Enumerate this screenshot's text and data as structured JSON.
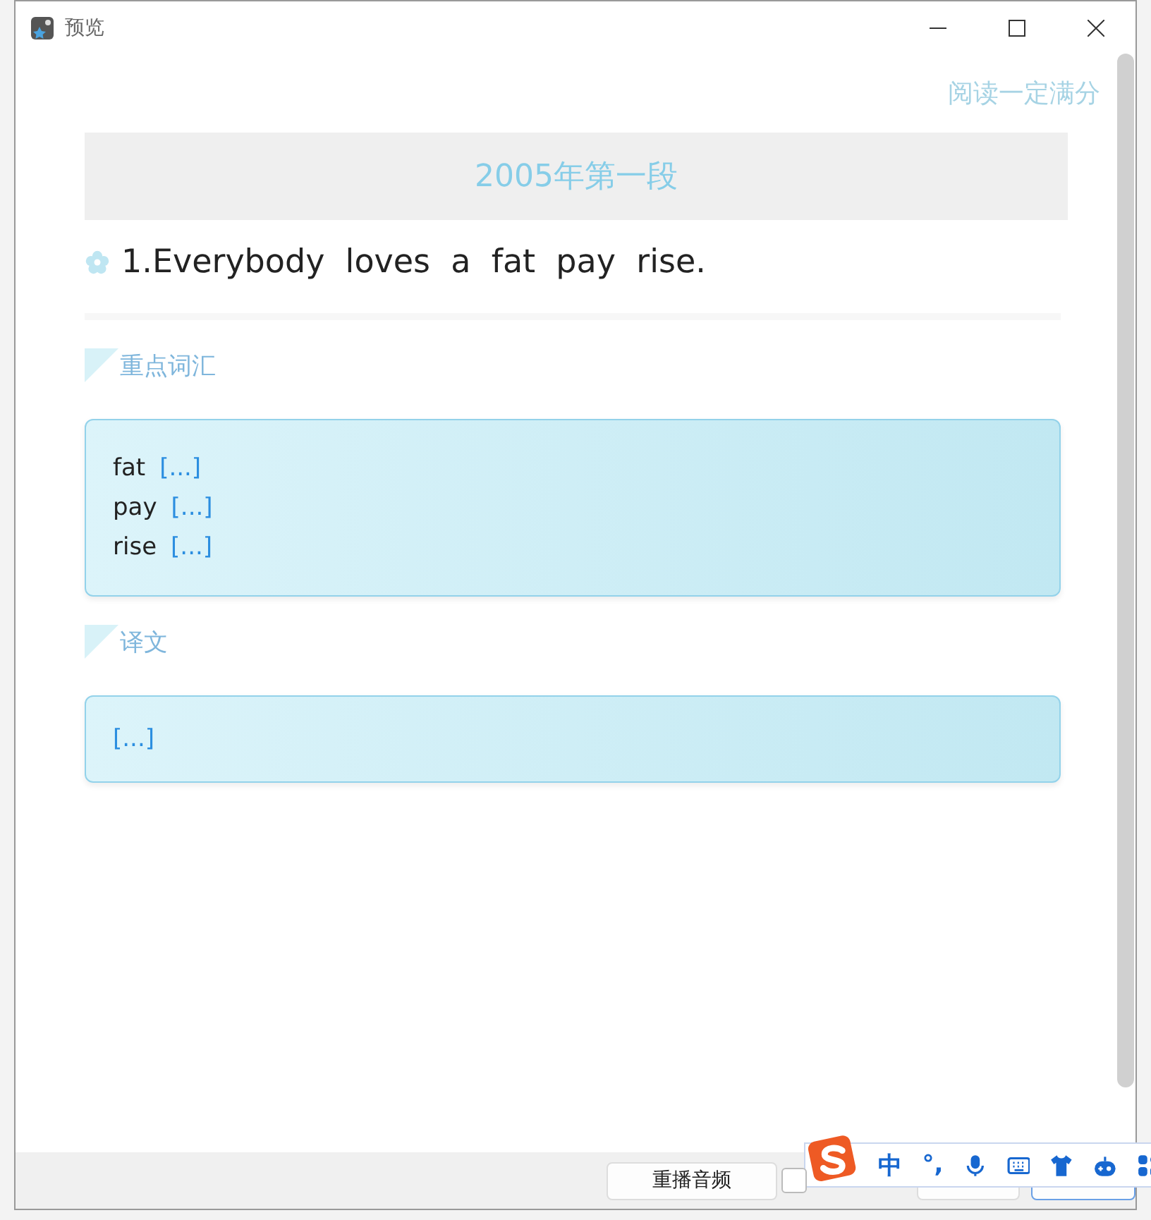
{
  "window": {
    "title": "预览"
  },
  "brand": "阅读一定满分",
  "section_title": "2005年第一段",
  "sentence": "1.Everybody  loves  a  fat  pay  rise.",
  "vocab": {
    "heading": "重点词汇",
    "items": [
      {
        "word": "fat",
        "meaning": "[...]"
      },
      {
        "word": "pay",
        "meaning": "[...]"
      },
      {
        "word": "rise",
        "meaning": "[...]"
      }
    ]
  },
  "translation": {
    "heading": "译文",
    "text": "[...]"
  },
  "footer": {
    "replay_button": "重播音频",
    "checkbox": {
      "checked": false
    }
  },
  "ime_toolbar": {
    "mode": "中",
    "punctuation": "°,"
  }
}
